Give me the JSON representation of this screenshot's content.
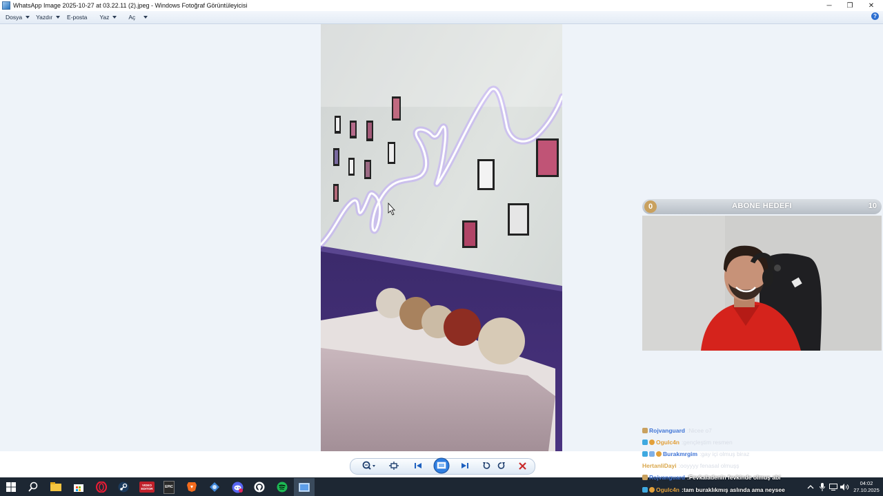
{
  "window": {
    "title": "WhatsApp Image 2025-10-27 at 03.22.11 (2).jpeg - Windows Fotoğraf Görüntüleyicisi",
    "minimize_glyph": "─",
    "restore_glyph": "❐",
    "close_glyph": "✕"
  },
  "menubar": {
    "items": [
      {
        "label": "Dosya",
        "has_dropdown": true
      },
      {
        "label": "Yazdır",
        "has_dropdown": true
      },
      {
        "label": "E-posta",
        "has_dropdown": false
      },
      {
        "label": "Yaz",
        "has_dropdown": true
      },
      {
        "label": "Aç",
        "has_dropdown": true
      }
    ],
    "help_label": "?"
  },
  "toolbar": {
    "buttons": [
      "zoom",
      "actual-size",
      "previous",
      "slideshow",
      "next",
      "rotate-left",
      "rotate-right",
      "delete"
    ]
  },
  "overlay": {
    "goal": {
      "current": "0",
      "label": "ABONE HEDEFI",
      "target": "10"
    },
    "chat": [
      {
        "user": "Rojvanguard",
        "sep": " : ",
        "message": "Nicee o7",
        "user_color": "#3f74d6",
        "badge": "#c9a15f",
        "strong": false
      },
      {
        "user": "Ogulc4n",
        "sep": " : ",
        "message": "gençleştim resmen",
        "user_color": "#e2a03a",
        "badge": "#3fa9e0",
        "strong": false
      },
      {
        "user": "Burakmrgim",
        "sep": " : ",
        "message": "gay içi olmuş biraz",
        "user_color": "#3f74d6",
        "badge": "#3fa9e0",
        "strong": false
      },
      {
        "user": "HertanliDayi",
        "sep": " : ",
        "message": "ooyyyy fenasal olmuşş",
        "user_color": "#d9a64a",
        "badge": "",
        "strong": false
      },
      {
        "user": "Rojvanguard",
        "sep": " : ",
        "message": "Fevkaladenin fevkinde olmuş abi",
        "user_color": "#3f74d6",
        "badge": "#c9a15f",
        "strong": true
      },
      {
        "user": "Ogulc4n",
        "sep": " : ",
        "message": "tam buraklıkmış aslında ama neysee",
        "user_color": "#e2a03a",
        "badge": "#3fa9e0",
        "strong": true
      }
    ]
  },
  "taskbar": {
    "icons": [
      "windows-start",
      "search",
      "file-explorer",
      "store",
      "opera-gx",
      "steam",
      "video-editor",
      "epic-games",
      "brave",
      "app-blue",
      "discord",
      "github",
      "spotify",
      "photo-viewer"
    ],
    "video_editor_label": "VIDEO EDITOR",
    "epic_label": "EPIC",
    "time": "04:02",
    "date": "27.10.2025"
  },
  "colors": {
    "viewer_bg": "#eef3f9",
    "taskbar_bg": "#1d2733",
    "close_red": "#c92a2a",
    "nav_blue": "#1c5fbf"
  }
}
